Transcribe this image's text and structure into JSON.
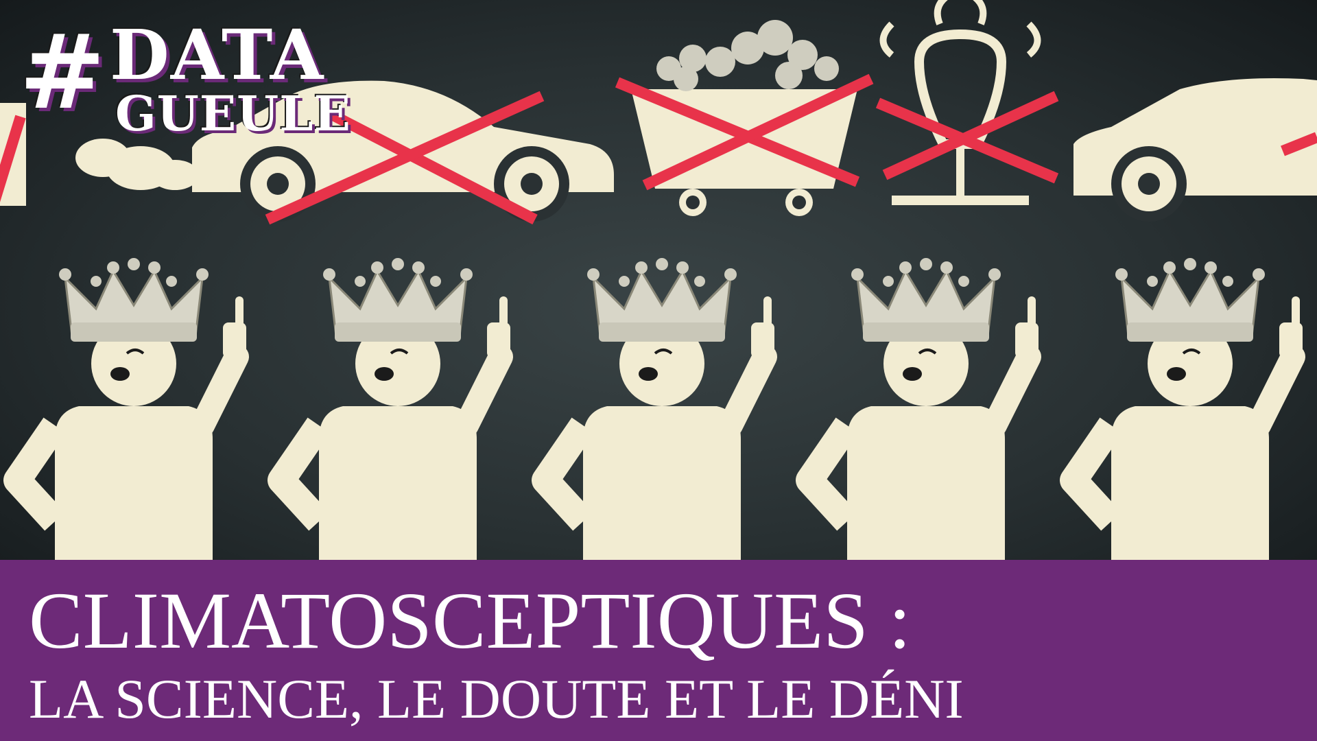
{
  "logo": {
    "hash": "#",
    "line1": "DATA",
    "line2": "GUEULE"
  },
  "title": {
    "line1": "CLIMATOSCEPTIQUES :",
    "line2": "LA SCIENCE, LE DOUTE ET LE DÉNI"
  },
  "colors": {
    "banner": "#6d2a78",
    "figure": "#f2ecd2",
    "cross": "#e8334a",
    "crown": "#d8d6c8"
  },
  "icons": [
    "car-icon",
    "coal-cart-icon",
    "light-bulb-icon",
    "car-icon",
    "crowned-figure-icon"
  ]
}
